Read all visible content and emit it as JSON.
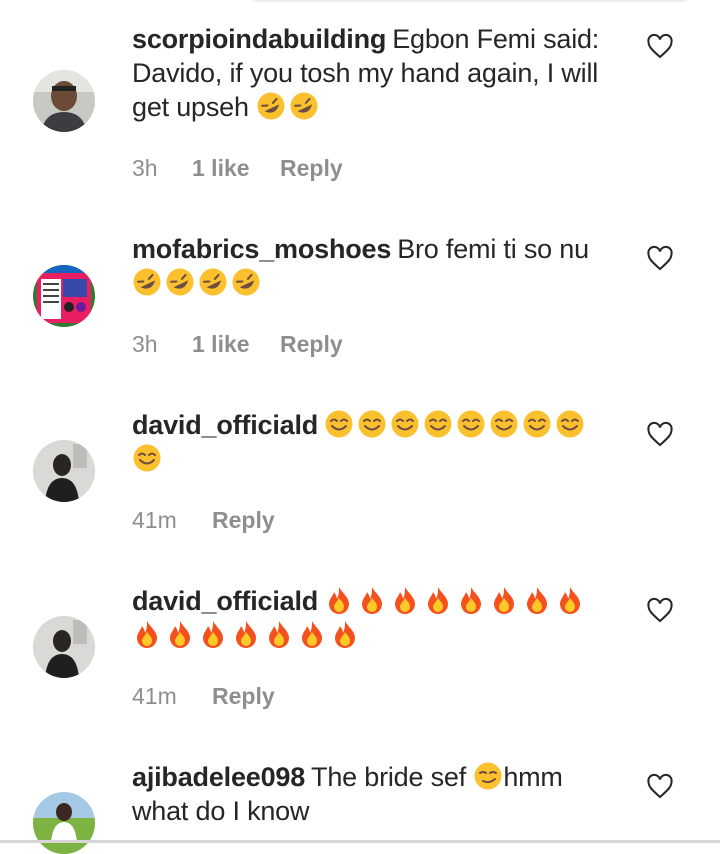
{
  "comments": [
    {
      "username": "scorpioindabuilding",
      "text": "Egbon Femi said: Davido, if you tosh my hand again, I will get upseh",
      "emoji": [
        "rofl-emoji",
        "rofl-emoji"
      ],
      "time": "3h",
      "likes": "1 like",
      "reply": "Reply"
    },
    {
      "username": "mofabrics_moshoes",
      "text": "Bro femi ti so nu",
      "emoji": [
        "rofl-emoji",
        "rofl-emoji",
        "rofl-emoji",
        "rofl-emoji"
      ],
      "time": "3h",
      "likes": "1 like",
      "reply": "Reply"
    },
    {
      "username": "david_officiald",
      "text": "",
      "emoji": [
        "smile-emoji",
        "smile-emoji",
        "smile-emoji",
        "smile-emoji",
        "smile-emoji",
        "smile-emoji",
        "smile-emoji",
        "smile-emoji",
        "smile-emoji"
      ],
      "time": "41m",
      "reply": "Reply"
    },
    {
      "username": "david_officiald",
      "text": "",
      "emoji": [
        "fire-emoji",
        "fire-emoji",
        "fire-emoji",
        "fire-emoji",
        "fire-emoji",
        "fire-emoji",
        "fire-emoji",
        "fire-emoji",
        "fire-emoji",
        "fire-emoji",
        "fire-emoji",
        "fire-emoji",
        "fire-emoji",
        "fire-emoji",
        "fire-emoji"
      ],
      "time": "41m",
      "reply": "Reply"
    },
    {
      "username": "ajibadelee098",
      "text_before": "The bride sef",
      "emoji": [
        "smirk-emoji"
      ],
      "text_after": "hmm what do I know"
    }
  ],
  "colors": {
    "text": "#262626",
    "meta": "#8e8e8e",
    "emoji_yellow": "#fbc02d",
    "fire": "#f4511e"
  }
}
